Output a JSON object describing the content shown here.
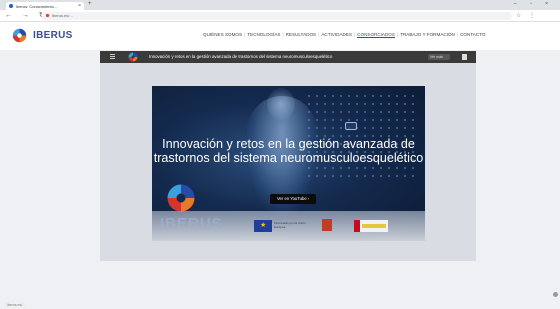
{
  "browser": {
    "tab_title": "Iberus: Conocimiento...",
    "new_tab": "+",
    "window_controls": "– ▫ ×",
    "nav_icons": "← → ↻ ⌂",
    "url": "iberus.es/…",
    "extensions": "☆ ⋮"
  },
  "site": {
    "brand": "IBERUS",
    "nav": [
      {
        "label": "QUIÉNES SOMOS"
      },
      {
        "label": "TECNOLOGÍAS"
      },
      {
        "label": "RESULTADOS"
      },
      {
        "label": "ACTIVIDADES"
      },
      {
        "label": "CONSORCIADOS"
      },
      {
        "label": "TRABAJO Y FORMACIÓN"
      },
      {
        "label": "CONTACTO"
      }
    ]
  },
  "video": {
    "title": "Innovación y retos en la gestión avanzada de trastornos del sistema neuromusculoesquelético",
    "share_label": "Ver más",
    "poster_title": "Innovación y retos en la gestión avanzada de trastornos del sistema neuromusculoesquelético",
    "watch_label": "Ver en YouTube ›",
    "poster_brand": "IBERUS",
    "funding_text": "Financiado por la Unión Europea"
  },
  "colors": {
    "brand": "#3d4e8a",
    "poster_bg": "#142a4e"
  }
}
